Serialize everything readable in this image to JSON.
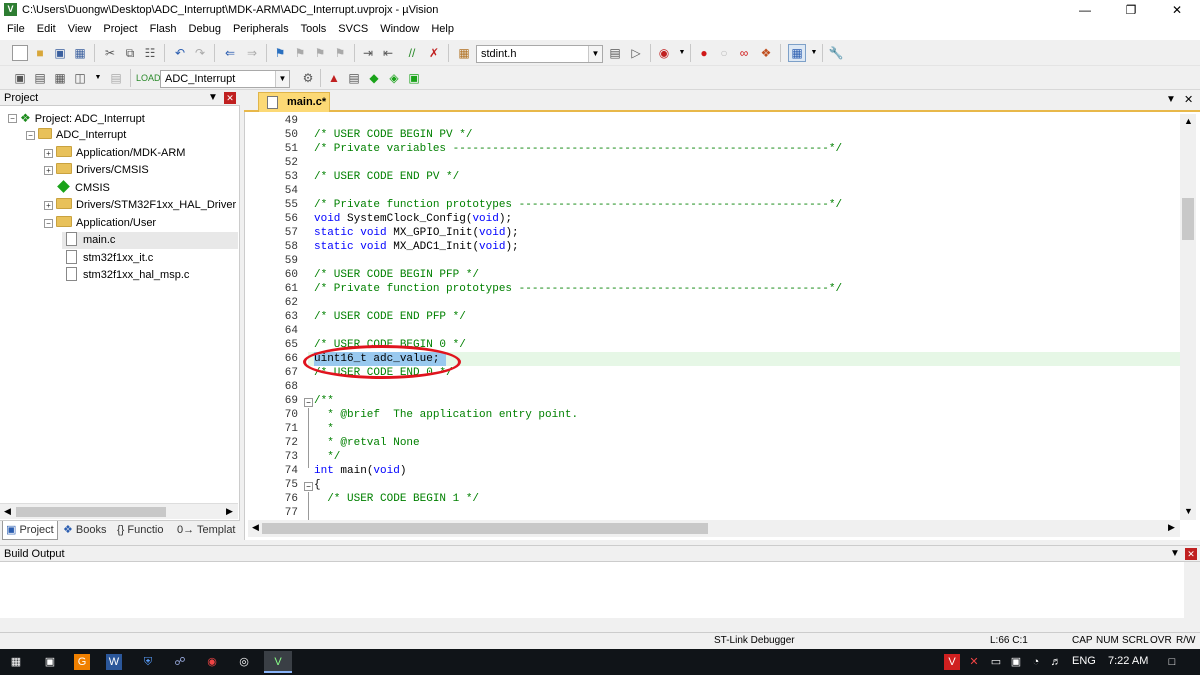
{
  "window": {
    "title": "C:\\Users\\Duongw\\Desktop\\ADC_Interrupt\\MDK-ARM\\ADC_Interrupt.uvprojx - µVision",
    "app_icon": "V"
  },
  "menu": [
    "File",
    "Edit",
    "View",
    "Project",
    "Flash",
    "Debug",
    "Peripherals",
    "Tools",
    "SVCS",
    "Window",
    "Help"
  ],
  "toolbar": {
    "find_combo": "stdint.h",
    "target_combo": "ADC_Interrupt"
  },
  "project_panel": {
    "title": "Project",
    "tree": [
      {
        "label": "Project: ADC_Interrupt",
        "level": 0,
        "type": "project"
      },
      {
        "label": "ADC_Interrupt",
        "level": 1,
        "type": "target"
      },
      {
        "label": "Application/MDK-ARM",
        "level": 2,
        "type": "folder"
      },
      {
        "label": "Drivers/CMSIS",
        "level": 2,
        "type": "folder"
      },
      {
        "label": "CMSIS",
        "level": 2,
        "type": "component"
      },
      {
        "label": "Drivers/STM32F1xx_HAL_Driver",
        "level": 2,
        "type": "folder"
      },
      {
        "label": "Application/User",
        "level": 2,
        "type": "folder-open"
      },
      {
        "label": "main.c",
        "level": 3,
        "type": "file"
      },
      {
        "label": "stm32f1xx_it.c",
        "level": 3,
        "type": "file"
      },
      {
        "label": "stm32f1xx_hal_msp.c",
        "level": 3,
        "type": "file"
      }
    ],
    "tabs": [
      "Project",
      "Books",
      "{} Functio",
      "0→ Templat"
    ]
  },
  "editor": {
    "tab": "main.c*",
    "lines": [
      {
        "n": "49",
        "text": ""
      },
      {
        "n": "50",
        "text": "/* USER CODE BEGIN PV */",
        "cls": "cm"
      },
      {
        "n": "51",
        "text": "/* Private variables ---------------------------------------------------------*/",
        "cls": "cm"
      },
      {
        "n": "52",
        "text": ""
      },
      {
        "n": "53",
        "text": "/* USER CODE END PV */",
        "cls": "cm"
      },
      {
        "n": "54",
        "text": ""
      },
      {
        "n": "55",
        "text": "/* Private function prototypes -----------------------------------------------*/",
        "cls": "cm"
      },
      {
        "n": "56",
        "text": "void SystemClock_Config(void);"
      },
      {
        "n": "57",
        "text": "static void MX_GPIO_Init(void);"
      },
      {
        "n": "58",
        "text": "static void MX_ADC1_Init(void);"
      },
      {
        "n": "59",
        "text": ""
      },
      {
        "n": "60",
        "text": "/* USER CODE BEGIN PFP */",
        "cls": "cm"
      },
      {
        "n": "61",
        "text": "/* Private function prototypes -----------------------------------------------*/",
        "cls": "cm"
      },
      {
        "n": "62",
        "text": ""
      },
      {
        "n": "63",
        "text": "/* USER CODE END PFP */",
        "cls": "cm"
      },
      {
        "n": "64",
        "text": ""
      },
      {
        "n": "65",
        "text": "/* USER CODE BEGIN 0 */",
        "cls": "cm"
      },
      {
        "n": "66",
        "text": "uint16_t adc_value;"
      },
      {
        "n": "67",
        "text": "/* USER CODE END 0 */",
        "cls": "cm"
      },
      {
        "n": "68",
        "text": ""
      },
      {
        "n": "69",
        "text": "/**",
        "cls": "cm"
      },
      {
        "n": "70",
        "text": "  * @brief  The application entry point.",
        "cls": "cm"
      },
      {
        "n": "71",
        "text": "  *",
        "cls": "cm"
      },
      {
        "n": "72",
        "text": "  * @retval None",
        "cls": "cm"
      },
      {
        "n": "73",
        "text": "  */",
        "cls": "cm"
      },
      {
        "n": "74",
        "text": "int main(void)"
      },
      {
        "n": "75",
        "text": "{"
      },
      {
        "n": "76",
        "text": "  /* USER CODE BEGIN 1 */",
        "cls": "cm"
      },
      {
        "n": "77",
        "text": ""
      }
    ]
  },
  "build_output": {
    "title": "Build Output"
  },
  "status": {
    "debugger": "ST-Link Debugger",
    "position": "L:66 C:1",
    "caps": "CAP",
    "num": "NUM",
    "scrl": "SCRL",
    "ovr": "OVR",
    "rw": "R/W"
  },
  "taskbar": {
    "lang": "ENG",
    "time": "7:22 AM"
  }
}
